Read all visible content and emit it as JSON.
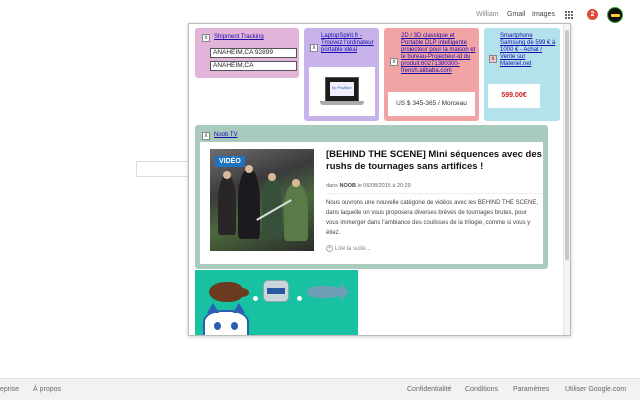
{
  "header": {
    "user": "William",
    "gmail": "Gmail",
    "images": "Images",
    "notifications": "2"
  },
  "ads": {
    "shipment": {
      "close": "x",
      "link": "Shipment Tracking",
      "field1": "ANAHEIM,CA 92899",
      "field2": "ANAHEIM,CA"
    },
    "laptop": {
      "close": "x",
      "link": "LaptopSpirit.fr - Trouvez l'ordinateur portable idéal",
      "brand": "hp Pavilion"
    },
    "projector": {
      "close": "x",
      "link": "2D / 3D classique et Portable DLP intelligente projecteur pour la maison et le bureau-Projecteur-id du produit:60271380300-french.alibaba.com",
      "price": "US $ 345-365 / Morceau"
    },
    "smartphone": {
      "close": "x",
      "link": "Smartphone Samsung de 599 € à 1000 € - Achat / Vente sur Materiel.net",
      "price": "599.00€"
    },
    "article": {
      "close": "x",
      "link": "Noob TV",
      "badge": "VIDÉO",
      "title": "[BEHIND THE SCENE] Mini séquences avec des rushs de tournages sans artifices !",
      "meta_prefix": "dans",
      "meta_author": "NOOB",
      "meta_suffix": "le 06/08/2015 à 20:29",
      "body": "Nous ouvrons une nouvelle catégorie de vidéos avec les BEHIND THE SCENE, dans laquelle on vous proposera diverses brèves de tournages brutes, pour vous immerger dans l'ambiance des coulisses de la trilogie, comme si vous y étiez.",
      "read_more": "Lire la suite..."
    }
  },
  "footer": {
    "links": [
      "eprise",
      "À propos",
      "Confidentialité",
      "Conditions",
      "Paramètres",
      "Utiliser Google.com"
    ]
  },
  "colors": {
    "ad_pink": "#e3b4d9",
    "ad_purple": "#c7b3ea",
    "ad_red": "#f2a4a4",
    "ad_blue": "#b3e2ec",
    "ad_green": "#a9cbbe",
    "ad_teal": "#17c1a1",
    "badge": "#dd4b39"
  }
}
